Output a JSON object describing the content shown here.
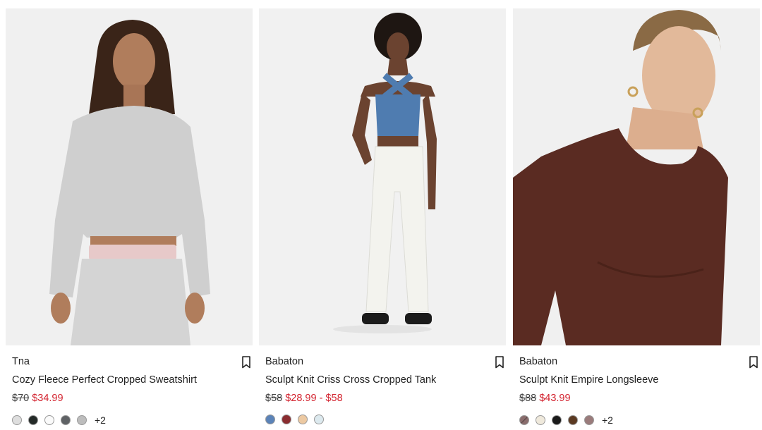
{
  "products": [
    {
      "brand": "Tna",
      "name": "Cozy Fleece Perfect Cropped Sweatshirt",
      "original_price": "$70",
      "sale_price": "$34.99",
      "swatches": [
        "#dedede",
        "#232a27",
        "#fafafa",
        "#5f6265",
        "#bdbdbd"
      ],
      "more_colors": "+2"
    },
    {
      "brand": "Babaton",
      "name": "Sculpt Knit Criss Cross Cropped Tank",
      "original_price": "$58",
      "sale_price": "$28.99 - $58",
      "swatches": [
        "#5b83b8",
        "#8a2d30",
        "#ecc9a2",
        "#dce9ee"
      ],
      "more_colors": ""
    },
    {
      "brand": "Babaton",
      "name": "Sculpt Knit Empire Longsleeve",
      "original_price": "$88",
      "sale_price": "$43.99",
      "swatches": [
        "#8a6d6d",
        "#efe9dc",
        "#1a1a1a",
        "#5b3a22",
        "#9a7b7b"
      ],
      "more_colors": "+2"
    }
  ],
  "colors": {
    "sale": "#d3232f",
    "text": "#222222"
  }
}
